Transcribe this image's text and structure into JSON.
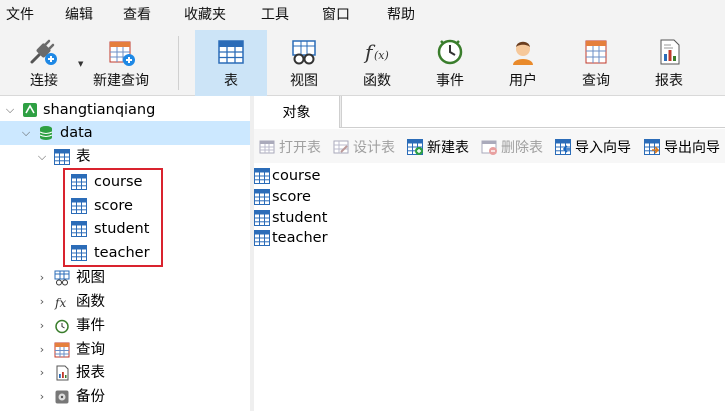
{
  "menu": [
    "文件",
    "编辑",
    "查看",
    "收藏夹",
    "工具",
    "窗口",
    "帮助"
  ],
  "toolbar": {
    "connect": "连接",
    "new_query": "新建查询",
    "table": "表",
    "view": "视图",
    "function": "函数",
    "event": "事件",
    "user": "用户",
    "query": "查询",
    "report": "报表"
  },
  "tree": {
    "connection": "shangtianqiang",
    "database": "data",
    "tables_node": "表",
    "tables": [
      "course",
      "score",
      "student",
      "teacher"
    ],
    "other_nodes": [
      "视图",
      "函数",
      "事件",
      "查询",
      "报表",
      "备份"
    ]
  },
  "tabs": {
    "objects": "对象"
  },
  "object_toolbar": {
    "open_table": "打开表",
    "design_table": "设计表",
    "new_table": "新建表",
    "delete_table": "删除表",
    "import_wizard": "导入向导",
    "export_wizard": "导出向导"
  },
  "objects": [
    "course",
    "score",
    "student",
    "teacher"
  ],
  "colors": {
    "selection": "#cce8ff",
    "toolbar_active": "#cce4f7",
    "highlight_border": "#d9232e"
  }
}
